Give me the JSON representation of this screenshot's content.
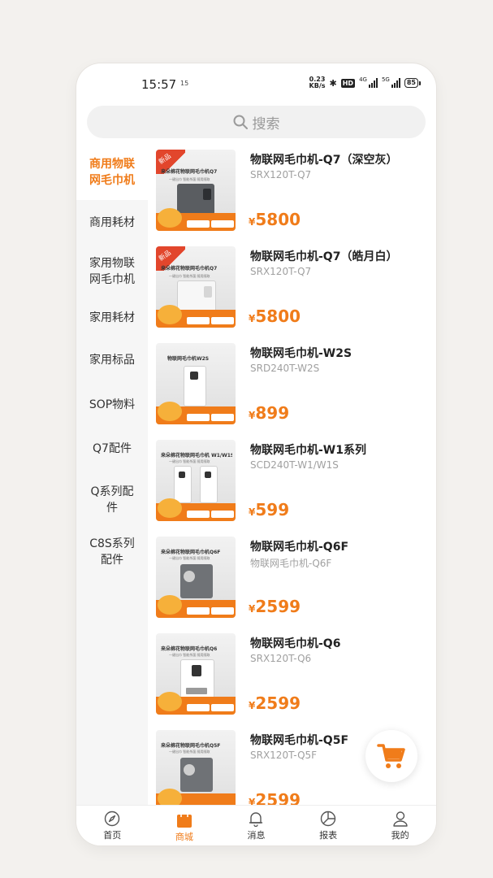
{
  "status_bar": {
    "time": "15:57",
    "notification": "15",
    "speed_value": "0.23",
    "speed_unit": "KB/s",
    "hd_label": "HD",
    "network_1": "4G",
    "network_2": "5G",
    "battery": "85"
  },
  "search": {
    "placeholder": "搜索",
    "icon": "search-icon"
  },
  "sidebar": {
    "items": [
      {
        "label": "商用物联\n网毛巾机",
        "active": true
      },
      {
        "label": "商用耗材",
        "active": false
      },
      {
        "label": "家用物联\n网毛巾机",
        "active": false
      },
      {
        "label": "家用耗材",
        "active": false
      },
      {
        "label": "家用标品",
        "active": false
      },
      {
        "label": "SOP物料",
        "active": false
      },
      {
        "label": "Q7配件",
        "active": false
      },
      {
        "label": "Q系列配\n件",
        "active": false
      },
      {
        "label": "C8S系列\n配件",
        "active": false
      }
    ]
  },
  "products": [
    {
      "name": "物联网毛巾机-Q7（深空灰）",
      "code": "SRX120T-Q7",
      "currency": "¥",
      "price": "5800",
      "thumb_title": "来朵棉花物联网毛巾机Q7",
      "thumb_sub": "一键出巾   智能杀菌   随用随取",
      "ribbon": "新品"
    },
    {
      "name": "物联网毛巾机-Q7（皓月白）",
      "code": "SRX120T-Q7",
      "currency": "¥",
      "price": "5800",
      "thumb_title": "来朵棉花物联网毛巾机Q7",
      "thumb_sub": "一键出巾   智能杀菌   随用随取",
      "ribbon": "新品"
    },
    {
      "name": "物联网毛巾机-W2S",
      "code": "SRD240T-W2S",
      "currency": "¥",
      "price": "899",
      "thumb_title": "物联网毛巾机W2S",
      "thumb_sub": "",
      "ribbon": ""
    },
    {
      "name": "物联网毛巾机-W1系列",
      "code": "SCD240T-W1/W1S",
      "currency": "¥",
      "price": "599",
      "thumb_title": "来朵棉花物联网毛巾机 W1/W1S",
      "thumb_sub": "一键出巾   智能杀菌   随用随取",
      "ribbon": ""
    },
    {
      "name": "物联网毛巾机-Q6F",
      "code": "物联网毛巾机-Q6F",
      "currency": "¥",
      "price": "2599",
      "thumb_title": "来朵棉花物联网毛巾机Q6F",
      "thumb_sub": "一键出巾   智能杀菌   随用随取",
      "ribbon": ""
    },
    {
      "name": "物联网毛巾机-Q6",
      "code": "SRX120T-Q6",
      "currency": "¥",
      "price": "2599",
      "thumb_title": "来朵棉花物联网毛巾机Q6",
      "thumb_sub": "一键出巾   智能杀菌   随用随取",
      "ribbon": ""
    },
    {
      "name": "物联网毛巾机-Q5F",
      "code": "SRX120T-Q5F",
      "currency": "¥",
      "price": "2599",
      "thumb_title": "来朵棉花物联网毛巾机Q5F",
      "thumb_sub": "一键出巾   智能杀菌   随用随取",
      "ribbon": ""
    }
  ],
  "cart": {
    "icon": "cart-icon"
  },
  "tabbar": {
    "items": [
      {
        "label": "首页",
        "icon": "compass-icon",
        "active": false
      },
      {
        "label": "商城",
        "icon": "shopping-bag-icon",
        "active": true
      },
      {
        "label": "消息",
        "icon": "bell-icon",
        "active": false
      },
      {
        "label": "报表",
        "icon": "pie-chart-icon",
        "active": false
      },
      {
        "label": "我的",
        "icon": "user-icon",
        "active": false
      }
    ]
  },
  "colors": {
    "accent": "#f07c1a",
    "ribbon": "#e2462c"
  }
}
